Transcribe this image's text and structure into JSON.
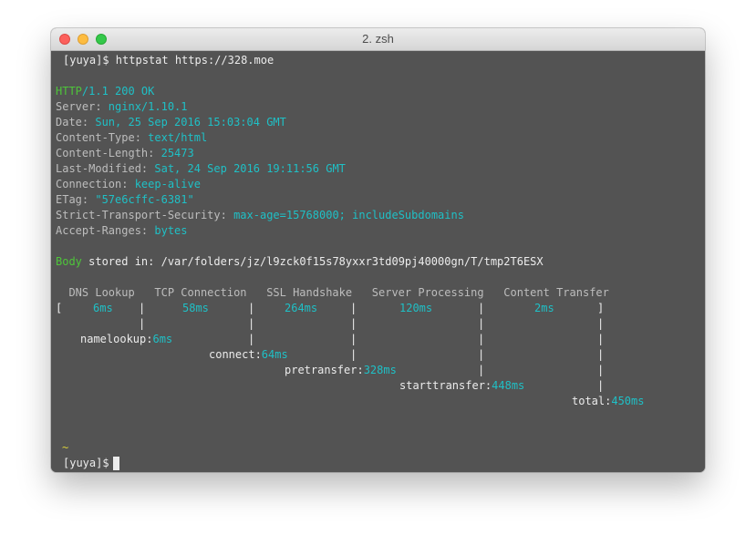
{
  "window": {
    "title": "2. zsh"
  },
  "terminal": {
    "prompt": "[yuya]$",
    "command": " httpstat https://328.moe",
    "status": {
      "proto": "HTTP",
      "rest": "/1.1 200 OK"
    },
    "headers": [
      {
        "key": "Server: ",
        "value": "nginx/1.10.1"
      },
      {
        "key": "Date: ",
        "value": "Sun, 25 Sep 2016 15:03:04 GMT"
      },
      {
        "key": "Content-Type: ",
        "value": "text/html"
      },
      {
        "key": "Content-Length: ",
        "value": "25473"
      },
      {
        "key": "Last-Modified: ",
        "value": "Sat, 24 Sep 2016 19:11:56 GMT"
      },
      {
        "key": "Connection: ",
        "value": "keep-alive"
      },
      {
        "key": "ETag: ",
        "value": "\"57e6cffc-6381\""
      },
      {
        "key": "Strict-Transport-Security: ",
        "value": "max-age=15768000; includeSubdomains"
      },
      {
        "key": "Accept-Ranges: ",
        "value": "bytes"
      }
    ],
    "body": {
      "label": "Body",
      "text": " stored in: /var/folders/jz/l9zck0f15s78yxxr3td09pj40000gn/T/tmp2T6ESX"
    },
    "timing": {
      "header_row": "  DNS Lookup   TCP Connection   SSL Handshake   Server Processing   Content Transfer",
      "bracket_open": "[",
      "bracket_close": "]",
      "sep": "|",
      "phases": [
        {
          "name": "DNS Lookup",
          "value": "6ms"
        },
        {
          "name": "TCP Connection",
          "value": "58ms"
        },
        {
          "name": "SSL Handshake",
          "value": "264ms"
        },
        {
          "name": "Server Processing",
          "value": "120ms"
        },
        {
          "name": "Content Transfer",
          "value": "2ms"
        }
      ],
      "cumulative": [
        {
          "label": "namelookup:",
          "value": "6ms"
        },
        {
          "label": "connect:",
          "value": "64ms"
        },
        {
          "label": "pretransfer:",
          "value": "328ms"
        },
        {
          "label": "starttransfer:",
          "value": "448ms"
        },
        {
          "label": "total:",
          "value": "450ms"
        }
      ]
    },
    "tilde": "~"
  }
}
